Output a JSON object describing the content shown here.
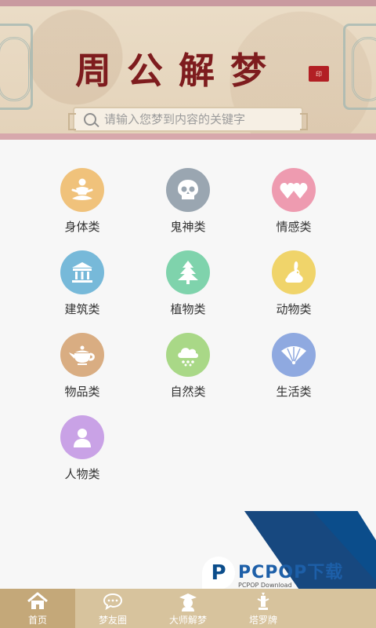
{
  "header": {
    "title": "周公解梦",
    "seal_text": "印",
    "search": {
      "placeholder": "请输入您梦到内容的关键字"
    }
  },
  "colors": {
    "header_bg": "#e8d8c0",
    "title": "#7e1c1e",
    "tabbar_bg": "#d7c39d",
    "tabbar_active": "#c4a879"
  },
  "categories": [
    {
      "label": "身体类",
      "icon": "meditation-icon",
      "color": "#f0c27b"
    },
    {
      "label": "鬼神类",
      "icon": "skull-icon",
      "color": "#9aa6b1"
    },
    {
      "label": "情感类",
      "icon": "hearts-icon",
      "color": "#ee9bb0"
    },
    {
      "label": "建筑类",
      "icon": "temple-icon",
      "color": "#77b9d9"
    },
    {
      "label": "植物类",
      "icon": "pine-tree-icon",
      "color": "#7fd3ac"
    },
    {
      "label": "动物类",
      "icon": "rabbit-icon",
      "color": "#f0d46a"
    },
    {
      "label": "物品类",
      "icon": "teapot-icon",
      "color": "#d9ad82"
    },
    {
      "label": "自然类",
      "icon": "rain-cloud-icon",
      "color": "#a9d887"
    },
    {
      "label": "生活类",
      "icon": "folding-fan-icon",
      "color": "#8fa9e0"
    },
    {
      "label": "人物类",
      "icon": "person-icon",
      "color": "#c9a2e6"
    }
  ],
  "promo": {
    "brand": "PCPOP下载",
    "sub": "PCPOP Download"
  },
  "tabs": [
    {
      "label": "首页",
      "icon": "home-icon"
    },
    {
      "label": "梦友圈",
      "icon": "chat-icon"
    },
    {
      "label": "大师解梦",
      "icon": "master-icon"
    },
    {
      "label": "塔罗牌",
      "icon": "tarot-icon"
    }
  ]
}
